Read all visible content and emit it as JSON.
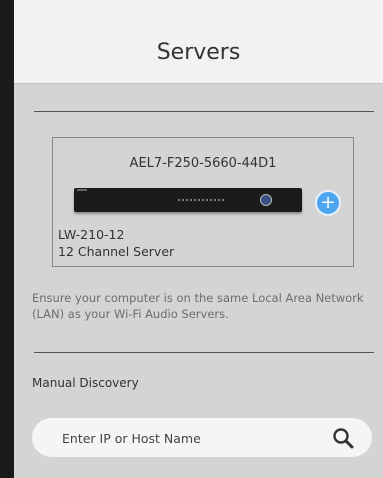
{
  "header": {
    "title": "Servers"
  },
  "server_card": {
    "device_id": "AEL7-F250-5660-44D1",
    "model": "LW-210-12",
    "description": "12 Channel Server",
    "add_icon": "plus-icon",
    "add_color": "#4ea6f0"
  },
  "info_text": "Ensure your computer is on the same Local Area Network (LAN) as your Wi-Fi Audio Servers.",
  "manual": {
    "label": "Manual Discovery",
    "search_placeholder": "Enter IP or Host Name",
    "search_icon": "search-icon"
  }
}
